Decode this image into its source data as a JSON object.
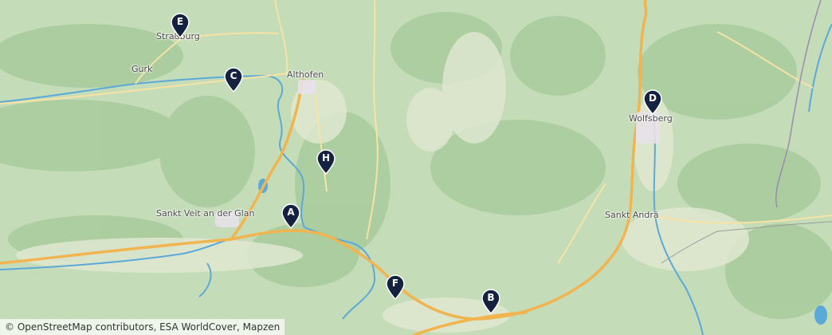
{
  "map": {
    "places": [
      {
        "id": "strasburg",
        "label": "Straßburg"
      },
      {
        "id": "gurk",
        "label": "Gurk"
      },
      {
        "id": "althofen",
        "label": "Althofen"
      },
      {
        "id": "wolfsberg",
        "label": "Wolfsberg"
      },
      {
        "id": "sankt-veit",
        "label": "Sankt Veit an der Glan"
      },
      {
        "id": "sankt-andra",
        "label": "Sankt Andrä"
      }
    ],
    "markers": [
      "E",
      "C",
      "H",
      "A",
      "D",
      "F",
      "B"
    ],
    "colors": {
      "land": "#c5dcb8",
      "forest": "#9fc595",
      "valley": "#e9ecdd",
      "road_major": "#f2b44f",
      "road_minor": "#f7e3a3",
      "water": "#5aa9d8",
      "marker": "#14223f"
    }
  },
  "attribution": "© OpenStreetMap contributors, ESA WorldCover, Mapzen"
}
